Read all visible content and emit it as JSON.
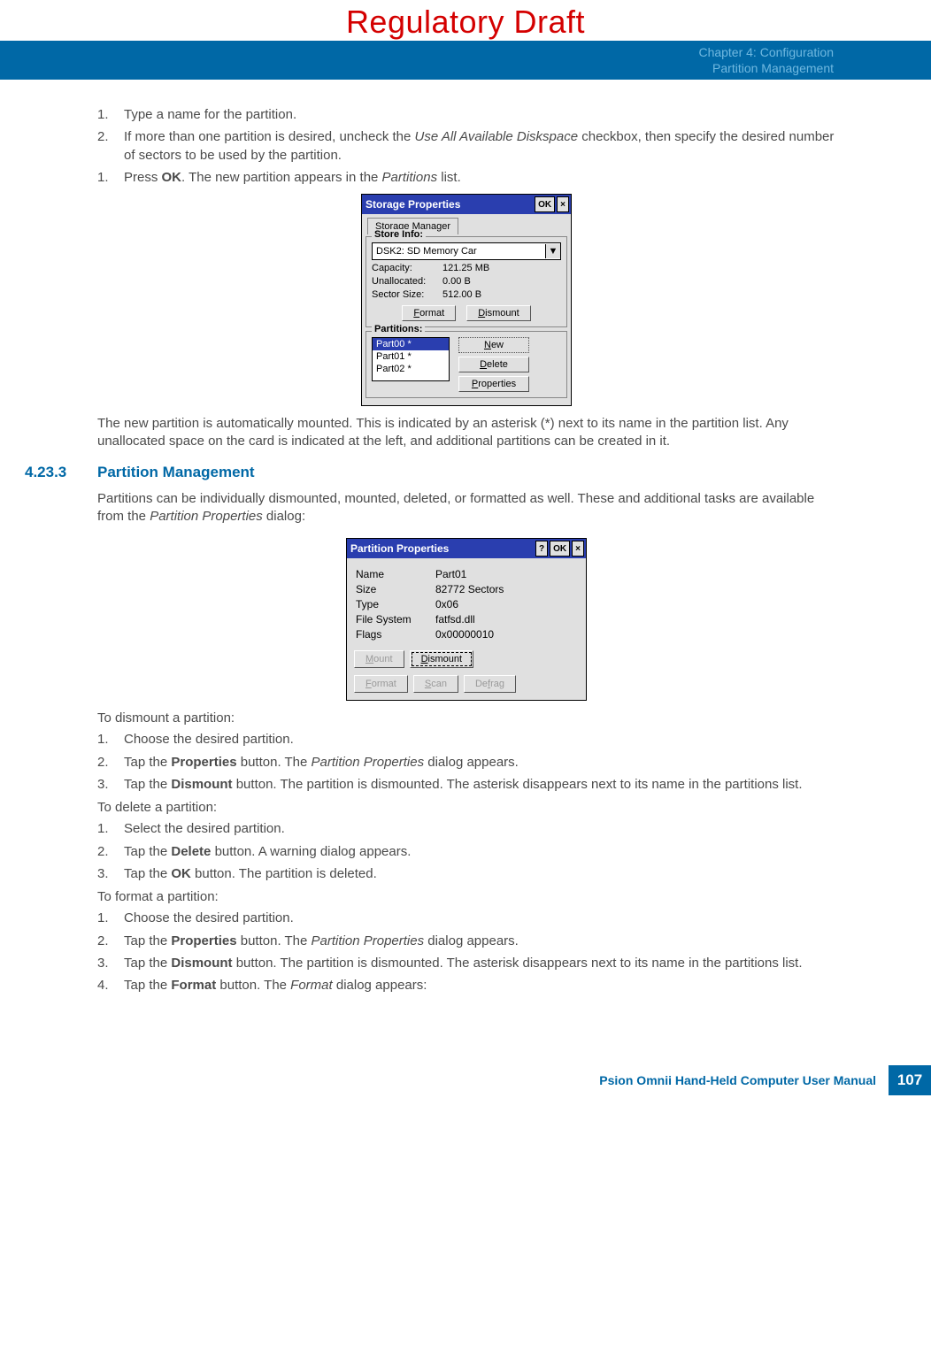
{
  "watermark": "Regulatory Draft",
  "chapter": {
    "line1": "Chapter 4:  Configuration",
    "line2": "Partition Management"
  },
  "intro_steps": [
    {
      "n": "1.",
      "t": "Type a name for the partition."
    },
    {
      "n": "2.",
      "t_pre": "If more than one partition is desired, uncheck the ",
      "t_i": "Use All Available Diskspace",
      "t_post": " checkbox, then specify the desired number of sectors to be used by the partition."
    },
    {
      "n": "1.",
      "t_pre": "Press ",
      "t_b": "OK",
      "t_mid": ". The new partition appears in the ",
      "t_i": "Partitions",
      "t_post": " list."
    }
  ],
  "dlg1": {
    "title": "Storage Properties",
    "ok": "OK",
    "tab": "Storage Manager",
    "store_legend": "Store Info:",
    "combo_text": "DSK2: SD Memory Car",
    "capacity_k": "Capacity:",
    "capacity_v": "121.25 MB",
    "unalloc_k": "Unallocated:",
    "unalloc_v": "0.00 B",
    "sector_k": "Sector Size:",
    "sector_v": "512.00 B",
    "format_btn": "Format",
    "dismount_btn": "Dismount",
    "part_legend": "Partitions:",
    "items": [
      "Part00 *",
      "Part01 *",
      "Part02 *"
    ],
    "new_btn": "New",
    "delete_btn": "Delete",
    "props_btn": "Properties"
  },
  "after_dlg1": "The new partition is automatically mounted. This is indicated by an asterisk (*) next to its name in the partition list. Any unallocated space on the card is indicated at the left, and additional partitions can be created in it.",
  "section": {
    "num": "4.23.3",
    "title": "Partition Management"
  },
  "section_intro_pre": "Partitions can be individually dismounted, mounted, deleted, or formatted as well. These and additional tasks are available from the ",
  "section_intro_i": "Partition Properties",
  "section_intro_post": " dialog:",
  "dlg2": {
    "title": "Partition Properties",
    "help": "?",
    "ok": "OK",
    "rows": [
      {
        "l": "Name",
        "v": "Part01"
      },
      {
        "l": "Size",
        "v": "82772 Sectors"
      },
      {
        "l": "Type",
        "v": "0x06"
      },
      {
        "l": "File System",
        "v": "fatfsd.dll"
      },
      {
        "l": "Flags",
        "v": "0x00000010"
      }
    ],
    "mount": "Mount",
    "dismount": "Dismount",
    "format": "Format",
    "scan": "Scan",
    "defrag": "Defrag"
  },
  "dismount_h": "To dismount a partition:",
  "dismount_steps": [
    {
      "n": "1.",
      "t": "Choose the desired partition."
    },
    {
      "n": "2.",
      "pre": "Tap the ",
      "b": "Properties",
      "mid": " button. The ",
      "i": "Partition Properties",
      "post": " dialog appears."
    },
    {
      "n": "3.",
      "pre": "Tap the ",
      "b": "Dismount",
      "post": " button. The partition is dismounted. The asterisk disappears next to its name in the partitions list."
    }
  ],
  "delete_h": "To delete a partition:",
  "delete_steps": [
    {
      "n": "1.",
      "t": "Select the desired partition."
    },
    {
      "n": "2.",
      "pre": "Tap the ",
      "b": "Delete",
      "post": " button. A warning dialog appears."
    },
    {
      "n": "3.",
      "pre": "Tap the ",
      "b": "OK",
      "post": " button. The partition is deleted."
    }
  ],
  "format_h": "To format a partition:",
  "format_steps": [
    {
      "n": "1.",
      "t": "Choose the desired partition."
    },
    {
      "n": "2.",
      "pre": "Tap the ",
      "b": "Properties",
      "mid": " button. The ",
      "i": "Partition Properties",
      "post": " dialog appears."
    },
    {
      "n": "3.",
      "pre": "Tap the ",
      "b": "Dismount",
      "post": " button. The partition is dismounted. The asterisk disappears next to its name in the partitions list."
    },
    {
      "n": "4.",
      "pre": "Tap the ",
      "b": "Format",
      "mid": " button. The ",
      "i": "Format",
      "post": " dialog appears:"
    }
  ],
  "footer": {
    "text": "Psion Omnii Hand-Held Computer User Manual",
    "page": "107"
  }
}
